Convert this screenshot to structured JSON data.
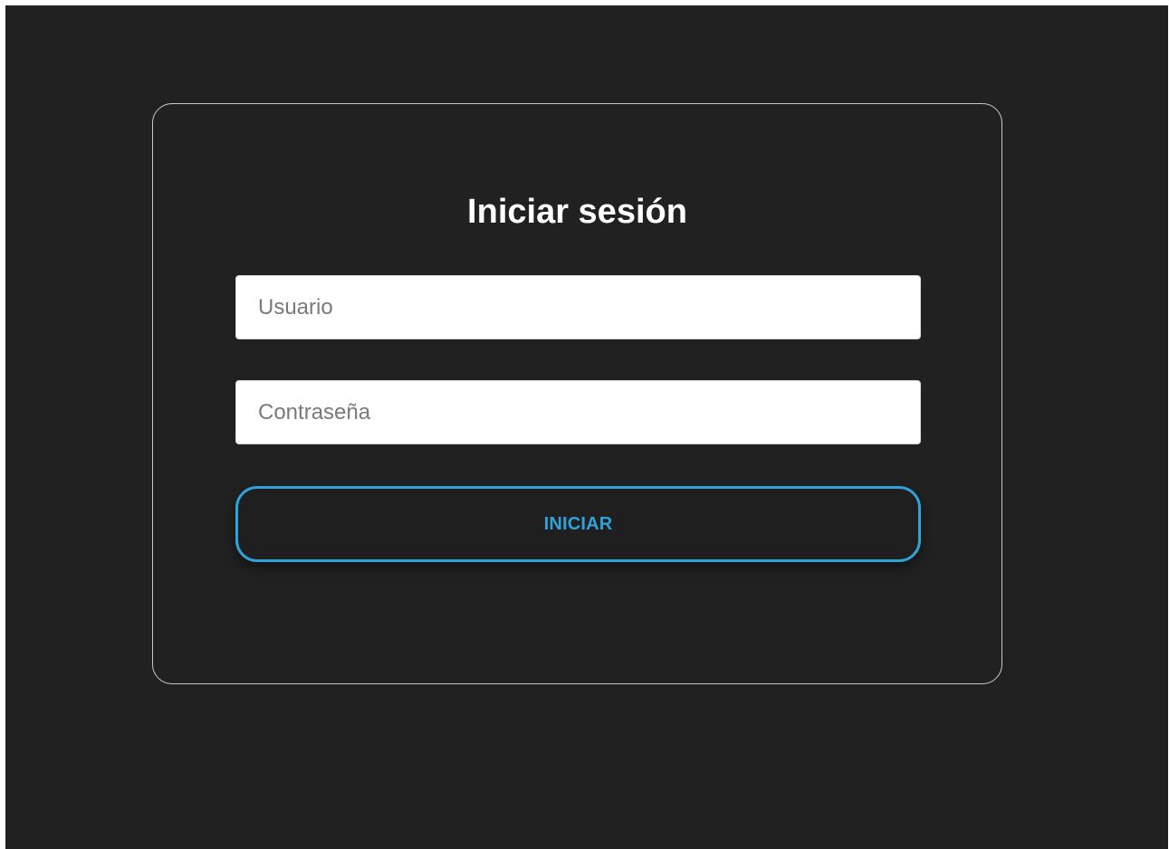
{
  "login": {
    "title": "Iniciar sesión",
    "username_placeholder": "Usuario",
    "username_value": "",
    "password_placeholder": "Contraseña",
    "password_value": "",
    "submit_label": "INICIAR"
  },
  "colors": {
    "background": "#212121",
    "card_border": "#c9c9c9",
    "accent": "#2fa3d9",
    "input_background": "#ffffff"
  }
}
